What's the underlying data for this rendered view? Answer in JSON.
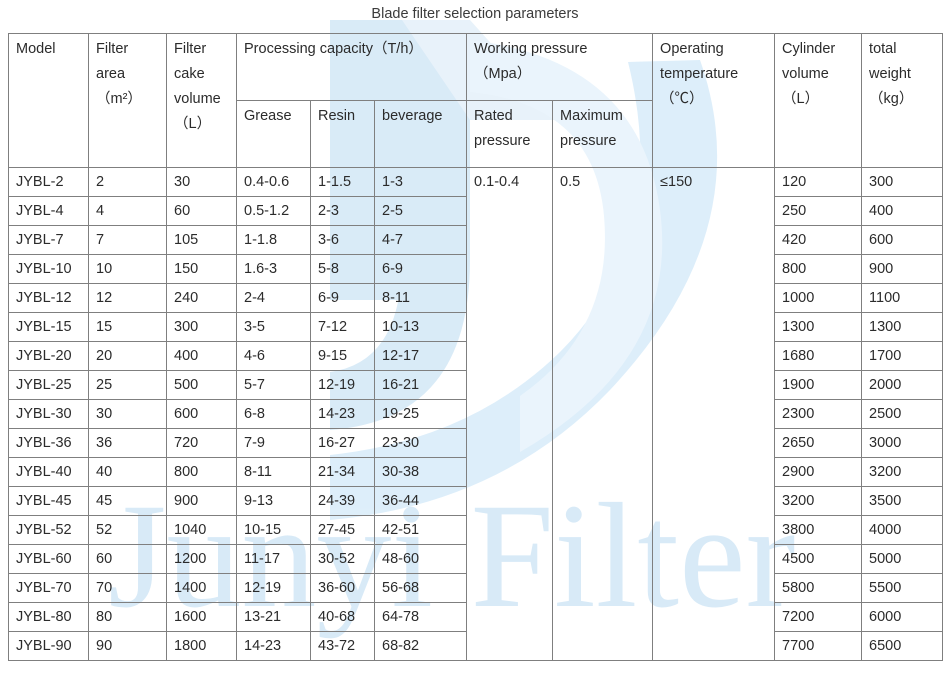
{
  "title": "Blade filter selection parameters",
  "watermark": {
    "brand_text": "Junyi Filter",
    "tint_color": "#d8eaf7",
    "logo_shape": "stylized-j-swoosh"
  },
  "table": {
    "header": {
      "model": "Model",
      "filter_area": "Filter area（m²）",
      "filter_area_l1": "Filter",
      "filter_area_l2": "area",
      "filter_area_l3": "（m²）",
      "filter_cake_volume_l1": "Filter",
      "filter_cake_volume_l2": "cake",
      "filter_cake_volume_l3": "volume",
      "filter_cake_volume_l4": "（L）",
      "processing_capacity": "Processing capacity（T/h）",
      "grease": "Grease",
      "resin": "Resin",
      "beverage": "beverage",
      "working_pressure_l1": "Working pressure",
      "working_pressure_l2": "（Mpa）",
      "rated_pressure_l1": "Rated",
      "rated_pressure_l2": "pressure",
      "maximum_pressure_l1": "Maximum",
      "maximum_pressure_l2": "pressure",
      "operating_temperature_l1": "Operating",
      "operating_temperature_l2": "temperature",
      "operating_temperature_l3": "（℃）",
      "cylinder_volume_l1": "Cylinder",
      "cylinder_volume_l2": "volume",
      "cylinder_volume_l3": "（L）",
      "total_weight_l1": "total",
      "total_weight_l2": "weight",
      "total_weight_l3": "（kg）"
    },
    "merged": {
      "rated_pressure_value": "0.1-0.4",
      "maximum_pressure_value": "0.5",
      "operating_temperature_value": "≤150"
    },
    "rows": [
      {
        "model": "JYBL-2",
        "area": "2",
        "cake": "30",
        "grease": "0.4-0.6",
        "resin": "1-1.5",
        "beverage": "1-3",
        "cylinder": "120",
        "weight": "300"
      },
      {
        "model": "JYBL-4",
        "area": "4",
        "cake": "60",
        "grease": "0.5-1.2",
        "resin": "2-3",
        "beverage": "2-5",
        "cylinder": "250",
        "weight": "400"
      },
      {
        "model": "JYBL-7",
        "area": "7",
        "cake": "105",
        "grease": "1-1.8",
        "resin": "3-6",
        "beverage": "4-7",
        "cylinder": "420",
        "weight": "600"
      },
      {
        "model": "JYBL-10",
        "area": "10",
        "cake": "150",
        "grease": "1.6-3",
        "resin": "5-8",
        "beverage": "6-9",
        "cylinder": "800",
        "weight": "900"
      },
      {
        "model": "JYBL-12",
        "area": "12",
        "cake": "240",
        "grease": "2-4",
        "resin": "6-9",
        "beverage": "8-11",
        "cylinder": "1000",
        "weight": "1100"
      },
      {
        "model": "JYBL-15",
        "area": "15",
        "cake": "300",
        "grease": "3-5",
        "resin": "7-12",
        "beverage": "10-13",
        "cylinder": "1300",
        "weight": "1300"
      },
      {
        "model": "JYBL-20",
        "area": "20",
        "cake": "400",
        "grease": "4-6",
        "resin": "9-15",
        "beverage": "12-17",
        "cylinder": "1680",
        "weight": "1700"
      },
      {
        "model": "JYBL-25",
        "area": "25",
        "cake": "500",
        "grease": "5-7",
        "resin": "12-19",
        "beverage": "16-21",
        "cylinder": "1900",
        "weight": "2000"
      },
      {
        "model": "JYBL-30",
        "area": "30",
        "cake": "600",
        "grease": "6-8",
        "resin": "14-23",
        "beverage": "19-25",
        "cylinder": "2300",
        "weight": "2500"
      },
      {
        "model": "JYBL-36",
        "area": "36",
        "cake": "720",
        "grease": "7-9",
        "resin": "16-27",
        "beverage": "23-30",
        "cylinder": "2650",
        "weight": "3000"
      },
      {
        "model": "JYBL-40",
        "area": "40",
        "cake": "800",
        "grease": "8-11",
        "resin": "21-34",
        "beverage": "30-38",
        "cylinder": "2900",
        "weight": "3200"
      },
      {
        "model": "JYBL-45",
        "area": "45",
        "cake": "900",
        "grease": "9-13",
        "resin": "24-39",
        "beverage": "36-44",
        "cylinder": "3200",
        "weight": "3500"
      },
      {
        "model": "JYBL-52",
        "area": "52",
        "cake": "1040",
        "grease": "10-15",
        "resin": "27-45",
        "beverage": "42-51",
        "cylinder": "3800",
        "weight": "4000"
      },
      {
        "model": "JYBL-60",
        "area": "60",
        "cake": "1200",
        "grease": "11-17",
        "resin": "30-52",
        "beverage": "48-60",
        "cylinder": "4500",
        "weight": "5000"
      },
      {
        "model": "JYBL-70",
        "area": "70",
        "cake": "1400",
        "grease": "12-19",
        "resin": "36-60",
        "beverage": "56-68",
        "cylinder": "5800",
        "weight": "5500"
      },
      {
        "model": "JYBL-80",
        "area": "80",
        "cake": "1600",
        "grease": "13-21",
        "resin": "40-68",
        "beverage": "64-78",
        "cylinder": "7200",
        "weight": "6000"
      },
      {
        "model": "JYBL-90",
        "area": "90",
        "cake": "1800",
        "grease": "14-23",
        "resin": "43-72",
        "beverage": "68-82",
        "cylinder": "7700",
        "weight": "6500"
      }
    ]
  }
}
